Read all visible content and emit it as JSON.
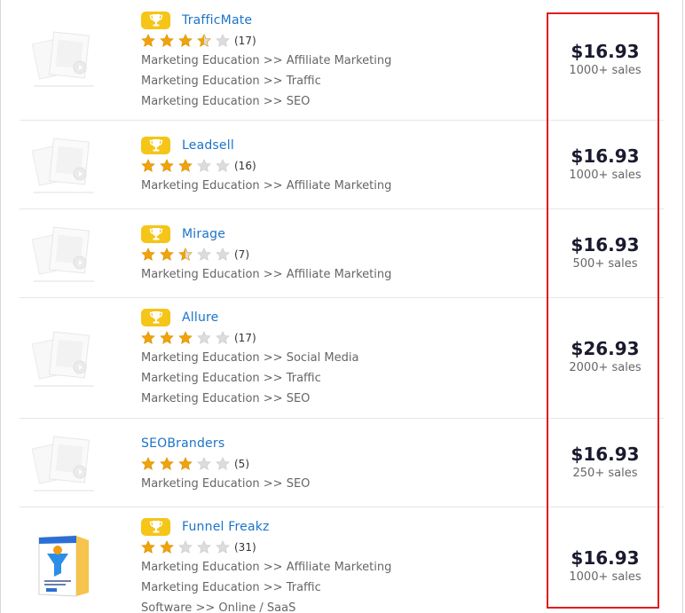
{
  "products": [
    {
      "title": "TrafficMate",
      "has_badge": true,
      "rating": 3.5,
      "reviews": "(17)",
      "categories": [
        "Marketing Education >> Affiliate Marketing",
        "Marketing Education >> Traffic",
        "Marketing Education >> SEO"
      ],
      "price": "$16.93",
      "sales": "1000+ sales",
      "thumb": "placeholder"
    },
    {
      "title": "Leadsell",
      "has_badge": true,
      "rating": 3,
      "reviews": "(16)",
      "categories": [
        "Marketing Education >> Affiliate Marketing"
      ],
      "price": "$16.93",
      "sales": "1000+ sales",
      "thumb": "placeholder"
    },
    {
      "title": "Mirage",
      "has_badge": true,
      "rating": 2.5,
      "reviews": "(7)",
      "categories": [
        "Marketing Education >> Affiliate Marketing"
      ],
      "price": "$16.93",
      "sales": "500+ sales",
      "thumb": "placeholder"
    },
    {
      "title": "Allure",
      "has_badge": true,
      "rating": 3,
      "reviews": "(17)",
      "categories": [
        "Marketing Education >> Social Media",
        "Marketing Education >> Traffic",
        "Marketing Education >> SEO"
      ],
      "price": "$26.93",
      "sales": "2000+ sales",
      "thumb": "placeholder"
    },
    {
      "title": "SEOBranders",
      "has_badge": false,
      "rating": 3,
      "reviews": "(5)",
      "categories": [
        "Marketing Education >> SEO"
      ],
      "price": "$16.93",
      "sales": "250+ sales",
      "thumb": "placeholder"
    },
    {
      "title": "Funnel Freakz",
      "has_badge": true,
      "rating": 2,
      "reviews": "(31)",
      "categories": [
        "Marketing Education >> Affiliate Marketing",
        "Marketing Education >> Traffic",
        "Software >> Online / SaaS"
      ],
      "price": "$16.93",
      "sales": "1000+ sales",
      "thumb": "product-box"
    }
  ],
  "colors": {
    "link": "#1b74c9",
    "star_filled": "#f0a30a",
    "star_empty": "#dcdcdc",
    "badge": "#f5c518",
    "highlight": "#e11d1d"
  },
  "icons": {
    "badge": "trophy-icon",
    "star": "star-icon",
    "placeholder": "no-image-placeholder-icon"
  }
}
